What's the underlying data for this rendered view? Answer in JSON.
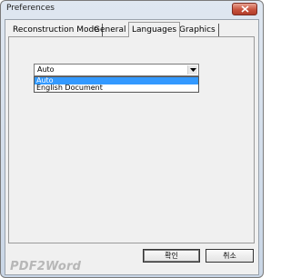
{
  "window": {
    "title": "Preferences"
  },
  "tabs": [
    {
      "label": "Reconstruction Mode"
    },
    {
      "label": "General"
    },
    {
      "label": "Languages",
      "active": true
    },
    {
      "label": "Graphics"
    }
  ],
  "language_select": {
    "value": "Auto",
    "options": [
      "Auto",
      "English Document"
    ],
    "highlighted": "Auto"
  },
  "footer": {
    "brand": "PDF2Word",
    "ok_label": "확인",
    "cancel_label": "취소"
  },
  "colors": {
    "highlight": "#3399ff",
    "close_button": "#c8523d"
  }
}
